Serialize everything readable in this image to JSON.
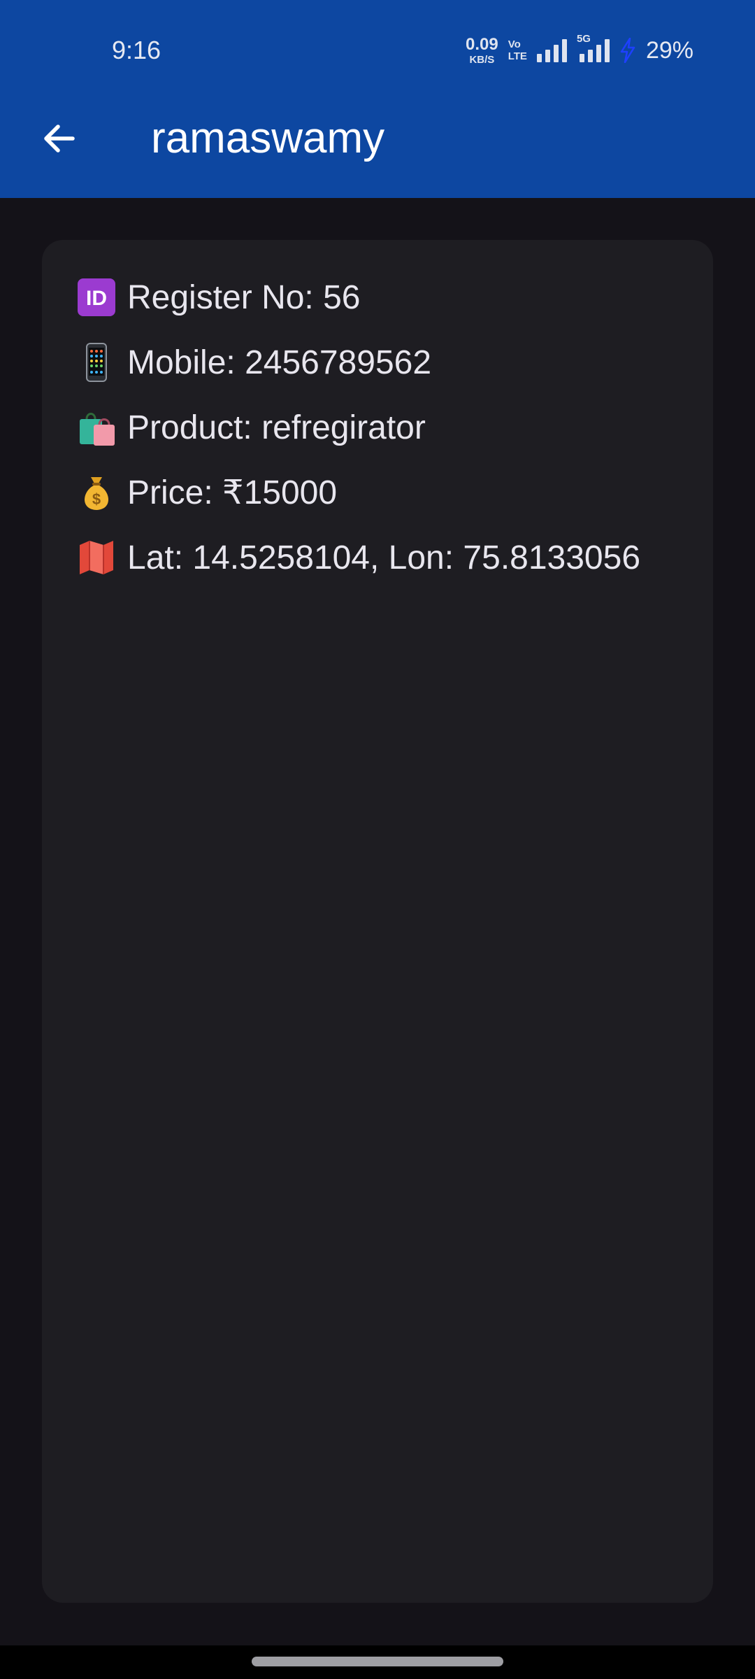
{
  "status_bar": {
    "time": "9:16",
    "net_speed_value": "0.09",
    "net_speed_unit": "KB/S",
    "volte_top": "Vo",
    "volte_bottom": "LTE",
    "network_type": "5G",
    "battery": "29%",
    "charging_color": "#1e40ff"
  },
  "app_bar": {
    "title": "ramaswamy",
    "background": "#0d47a1",
    "back_icon": "arrow-left-icon"
  },
  "details": [
    {
      "icon": "id-icon",
      "text": "Register No: 56"
    },
    {
      "icon": "mobile-phone-icon",
      "text": "Mobile: 2456789562"
    },
    {
      "icon": "shopping-bags-icon",
      "text": "Product: refregirator"
    },
    {
      "icon": "money-bag-icon",
      "text": "Price: ₹15000"
    },
    {
      "icon": "map-icon",
      "text": "Lat: 14.5258104, Lon: 75.8133056"
    }
  ],
  "colors": {
    "page_background": "#141218",
    "card_background": "#1e1d22",
    "text": "#e8e6ee"
  }
}
